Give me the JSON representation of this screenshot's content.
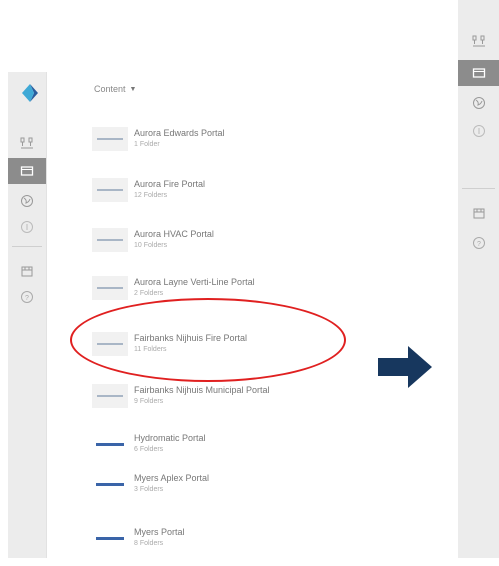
{
  "header": {
    "content_label": "Content"
  },
  "portals": [
    {
      "title": "Aurora Edwards Portal",
      "subtitle": "1 Folder"
    },
    {
      "title": "Aurora Fire Portal",
      "subtitle": "12 Folders"
    },
    {
      "title": "Aurora HVAC Portal",
      "subtitle": "10 Folders"
    },
    {
      "title": "Aurora Layne Verti-Line Portal",
      "subtitle": "2 Folders"
    },
    {
      "title": "Fairbanks Nijhuis Fire Portal",
      "subtitle": "11 Folders"
    },
    {
      "title": "Fairbanks Nijhuis Municipal Portal",
      "subtitle": "9 Folders"
    },
    {
      "title": "Hydromatic Portal",
      "subtitle": "6 Folders"
    },
    {
      "title": "Myers Aplex Portal",
      "subtitle": "3 Folders"
    },
    {
      "title": "Myers Portal",
      "subtitle": "8 Folders"
    }
  ],
  "rail_icons": [
    "org-chart-icon",
    "content-icon",
    "globe-icon",
    "info-icon",
    "store-icon",
    "help-icon"
  ],
  "colors": {
    "highlight": "#e02020",
    "arrow": "#17375e",
    "active_rail": "#8c8c8c"
  }
}
